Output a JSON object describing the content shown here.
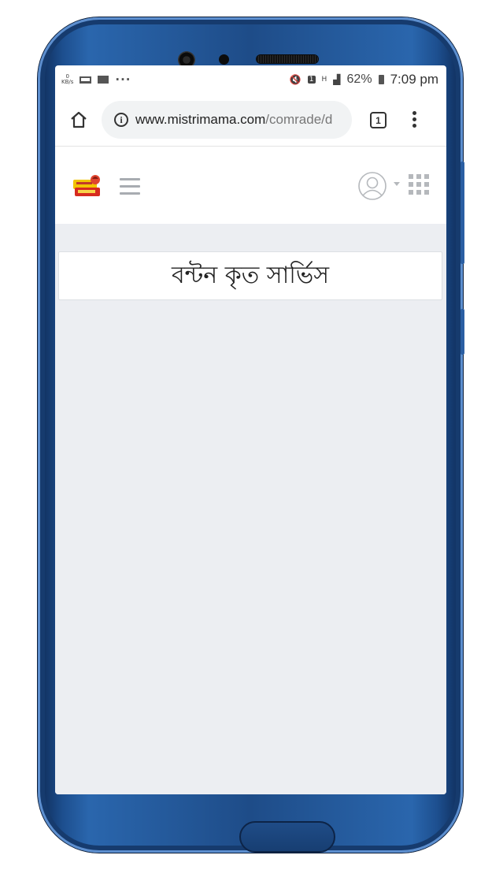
{
  "status_bar": {
    "kbs_value": "0",
    "kbs_unit": "KB/s",
    "more": "···",
    "network_h": "H",
    "battery_percent": "62%",
    "time": "7:09 pm"
  },
  "browser": {
    "url_domain": "www.mistrimama.com",
    "url_path": "/comrade/d",
    "tab_count": "1"
  },
  "page": {
    "title": "বন্টন কৃত সার্ভিস"
  },
  "colors": {
    "content_bg": "#eceef2",
    "icon_gray": "#b5b8bc",
    "phone_frame": "#1e4c88"
  }
}
